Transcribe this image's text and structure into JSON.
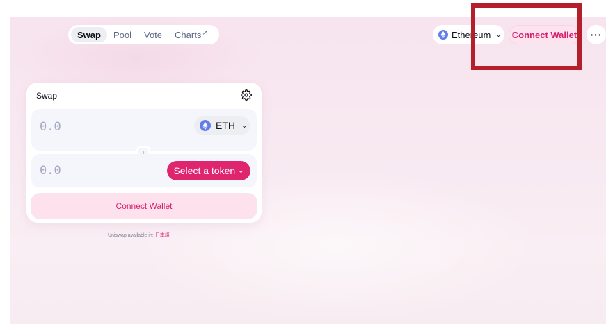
{
  "nav": {
    "tabs": [
      {
        "label": "Swap",
        "active": true
      },
      {
        "label": "Pool",
        "active": false
      },
      {
        "label": "Vote",
        "active": false
      },
      {
        "label": "Charts",
        "active": false,
        "external": true
      }
    ],
    "external_arrow": "↗"
  },
  "header": {
    "network": {
      "label": "Ethereum",
      "icon": "ethereum-icon"
    },
    "connect_label": "Connect Wallet",
    "more_label": "···"
  },
  "swap": {
    "title": "Swap",
    "settings_icon": "gear-icon",
    "input": {
      "placeholder": "0.0",
      "token": "ETH"
    },
    "output": {
      "placeholder": "0.0",
      "token_button": "Select a token"
    },
    "switch_icon": "arrow-down-icon",
    "connect_label": "Connect Wallet"
  },
  "footer": {
    "available_text": "Uniswap available in:",
    "language": "日本語"
  },
  "colors": {
    "accent": "#e0256f",
    "accent_soft": "#fde1ec",
    "annotation": "#b51f2c"
  }
}
